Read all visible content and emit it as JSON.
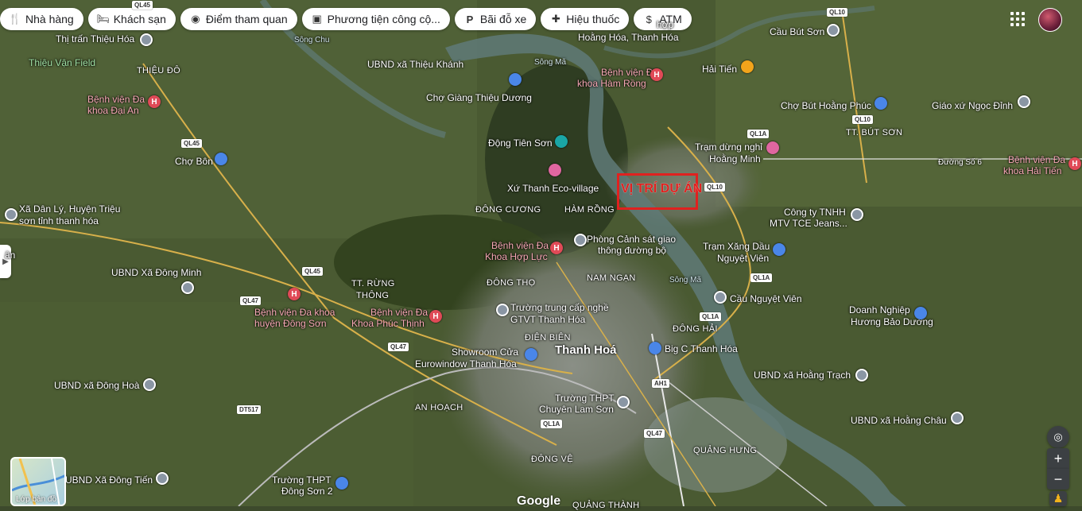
{
  "chips": [
    {
      "label": "Nhà hàng",
      "icon": "fork-knife-icon",
      "glyph": "🍴"
    },
    {
      "label": "Khách sạn",
      "icon": "bed-icon",
      "glyph": "🛏"
    },
    {
      "label": "Điểm tham quan",
      "icon": "camera-icon",
      "glyph": "◉"
    },
    {
      "label": "Phương tiện công cộ...",
      "icon": "bus-icon",
      "glyph": "▣"
    },
    {
      "label": "Bãi đỗ xe",
      "icon": "parking-icon",
      "glyph": "P"
    },
    {
      "label": "Hiệu thuốc",
      "icon": "pharmacy-icon",
      "glyph": "✚"
    },
    {
      "label": "ATM",
      "icon": "atm-icon",
      "glyph": "$"
    }
  ],
  "highlight": {
    "label": "VỊ TRÍ DỰ ÁN",
    "color": "#e0211f"
  },
  "places": [
    {
      "text": "Thị trấn Thiệu Hóa",
      "kind": "white"
    },
    {
      "text": "THIỆU ĐÔ",
      "kind": "district"
    },
    {
      "text": "Thiệu Vận Field",
      "kind": "green"
    },
    {
      "text": "Bệnh viện Đa",
      "kind": "pink"
    },
    {
      "text": "khoa Đại An",
      "kind": "pink"
    },
    {
      "text": "Chợ Bôn",
      "kind": "white"
    },
    {
      "text": "Xã Dân Lý, Huyện Triệu",
      "kind": "white"
    },
    {
      "text": "sơn tỉnh thanh hóa",
      "kind": "white"
    },
    {
      "text": "UBND Xã Đông Minh",
      "kind": "white"
    },
    {
      "text": "Bệnh viện Đa khoa",
      "kind": "pink"
    },
    {
      "text": "huyện Đông Sơn",
      "kind": "pink"
    },
    {
      "text": "UBND xã Đông Hoà",
      "kind": "white"
    },
    {
      "text": "UBND Xã Đông Tiến",
      "kind": "white"
    },
    {
      "text": "Trường THPT",
      "kind": "white"
    },
    {
      "text": "Đông Sơn 2",
      "kind": "white"
    },
    {
      "text": "UBND xã Thiệu Khánh",
      "kind": "white"
    },
    {
      "text": "Chợ Giàng Thiệu Dương",
      "kind": "white"
    },
    {
      "text": "Động Tiên Sơn",
      "kind": "white"
    },
    {
      "text": "Xứ Thanh Eco-village",
      "kind": "white"
    },
    {
      "text": "ĐÔNG CƯƠNG",
      "kind": "district"
    },
    {
      "text": "HÀM RỒNG",
      "kind": "district"
    },
    {
      "text": "Bệnh viện Đa",
      "kind": "pink"
    },
    {
      "text": "Khoa Hợp Lực",
      "kind": "pink"
    },
    {
      "text": "Phòng Cảnh sát giao",
      "kind": "white"
    },
    {
      "text": "thông đường bộ",
      "kind": "white"
    },
    {
      "text": "TT. RỪNG",
      "kind": "district"
    },
    {
      "text": "THÔNG",
      "kind": "district"
    },
    {
      "text": "Bệnh viện Đa",
      "kind": "pink"
    },
    {
      "text": "Khoa Phúc Thịnh",
      "kind": "pink"
    },
    {
      "text": "ĐÔNG THỌ",
      "kind": "district"
    },
    {
      "text": "NAM NGẠN",
      "kind": "district"
    },
    {
      "text": "Trường trung cấp nghề",
      "kind": "white"
    },
    {
      "text": "GTVT Thanh Hóa",
      "kind": "white"
    },
    {
      "text": "ĐIỆN BIÊN",
      "kind": "district"
    },
    {
      "text": "Showroom Cửa",
      "kind": "white"
    },
    {
      "text": "Eurowindow Thanh Hóa",
      "kind": "white"
    },
    {
      "text": "Thanh Hoá",
      "kind": "big"
    },
    {
      "text": "Trường THPT",
      "kind": "white"
    },
    {
      "text": "Chuyên Lam Sơn",
      "kind": "white"
    },
    {
      "text": "AN HOẠCH",
      "kind": "district"
    },
    {
      "text": "ĐÔNG VỆ",
      "kind": "district"
    },
    {
      "text": "QUẢNG HƯNG",
      "kind": "district"
    },
    {
      "text": "QUẢNG THÀNH",
      "kind": "district"
    },
    {
      "text": "Hoằng Hóa, Thanh Hóa",
      "kind": "white"
    },
    {
      "text": "Bệnh viện Đa",
      "kind": "pink"
    },
    {
      "text": "khoa Hàm Rồng",
      "kind": "pink"
    },
    {
      "text": "Hải Tiến",
      "kind": "white"
    },
    {
      "text": "Cầu Bút Sơn",
      "kind": "white"
    },
    {
      "text": "Chợ Bút Hoằng Phúc",
      "kind": "white"
    },
    {
      "text": "Giáo xứ Ngọc Đỉnh",
      "kind": "white"
    },
    {
      "text": "TT. BÚT SƠN",
      "kind": "district"
    },
    {
      "text": "Trạm dừng nghỉ",
      "kind": "white"
    },
    {
      "text": "Hoằng Minh",
      "kind": "white"
    },
    {
      "text": "Bệnh viện Đa",
      "kind": "pink"
    },
    {
      "text": "khoa Hải Tiến",
      "kind": "pink"
    },
    {
      "text": "Công ty TNHH",
      "kind": "white"
    },
    {
      "text": "MTV TCE Jeans...",
      "kind": "white"
    },
    {
      "text": "Trạm Xăng Dầu",
      "kind": "white"
    },
    {
      "text": "Nguyệt Viên",
      "kind": "white"
    },
    {
      "text": "Cầu Nguyệt Viên",
      "kind": "white"
    },
    {
      "text": "Doanh Nghiệp",
      "kind": "white"
    },
    {
      "text": "Hương Bảo Dương",
      "kind": "white"
    },
    {
      "text": "ĐÔNG HẢI",
      "kind": "district"
    },
    {
      "text": "Big C Thanh Hóa",
      "kind": "white"
    },
    {
      "text": "UBND xã Hoằng Trạch",
      "kind": "white"
    },
    {
      "text": "UBND xã Hoằng Châu",
      "kind": "white"
    },
    {
      "text": "hợp",
      "kind": "white"
    },
    {
      "text": "ân",
      "kind": "white"
    }
  ],
  "roads": [
    "QL45",
    "QL45",
    "QL45",
    "QL47",
    "QL47",
    "QL47",
    "QL1A",
    "QL1A",
    "QL1A",
    "QL1A",
    "QL10",
    "QL10",
    "QL10",
    "AH1",
    "DT517",
    "Đường Số 6",
    "Sông Mã",
    "Sông Mã",
    "Sông Chu"
  ],
  "controls": {
    "zoom_in": "+",
    "zoom_out": "−",
    "layer_label": "Lớp bản đồ",
    "google": "Google"
  },
  "colors": {
    "frame": "#e0211f",
    "hospital": "#e04a57",
    "pink_text": "#f7a8b5"
  }
}
